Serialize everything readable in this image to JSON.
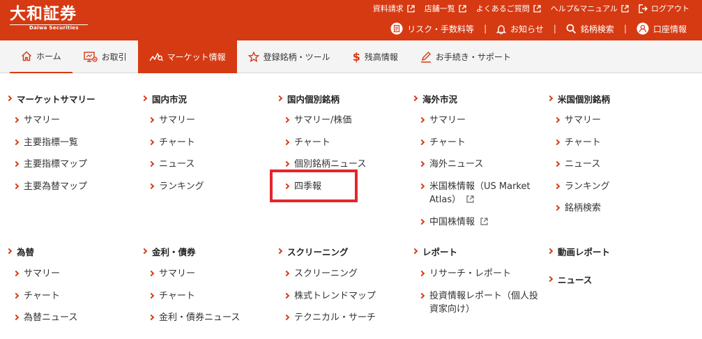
{
  "brand": {
    "logo_main": "大和証券",
    "logo_sub": "Daiwa Securities"
  },
  "top_links": [
    "資料請求",
    "店舗一覧",
    "よくあるご質問",
    "ヘルプ&マニュアル",
    "ログアウト"
  ],
  "sub_links": {
    "risk": "リスク・手数料等",
    "notice": "お知らせ",
    "search": "銘柄検索",
    "account": "口座情報"
  },
  "nav": {
    "home": "ホーム",
    "trade": "お取引",
    "market": "マーケット情報",
    "watchlist": "登録銘柄・ツール",
    "balance": "残高情報",
    "procedures": "お手続き・サポート"
  },
  "menu": {
    "market_summary": {
      "title": "マーケットサマリー",
      "items": [
        "サマリー",
        "主要指標一覧",
        "主要指標マップ",
        "主要為替マップ"
      ]
    },
    "domestic": {
      "title": "国内市況",
      "items": [
        "サマリー",
        "チャート",
        "ニュース",
        "ランキング"
      ]
    },
    "domestic_stocks": {
      "title": "国内個別銘柄",
      "items": [
        "サマリー/株価",
        "チャート",
        "個別銘柄ニュース",
        "四季報"
      ]
    },
    "overseas": {
      "title": "海外市況",
      "items": [
        "サマリー",
        "チャート",
        "海外ニュース",
        "米国株情報（US Market Atlas）",
        "中国株情報"
      ]
    },
    "us_stocks": {
      "title": "米国個別銘柄",
      "items": [
        "サマリー",
        "チャート",
        "ニュース",
        "ランキング",
        "銘柄検索"
      ]
    },
    "fx": {
      "title": "為替",
      "items": [
        "サマリー",
        "チャート",
        "為替ニュース"
      ]
    },
    "rates": {
      "title": "金利・債券",
      "items": [
        "サマリー",
        "チャート",
        "金利・債券ニュース"
      ]
    },
    "screening": {
      "title": "スクリーニング",
      "items": [
        "スクリーニング",
        "株式トレンドマップ",
        "テクニカル・サーチ"
      ]
    },
    "report": {
      "title": "レポート",
      "items": [
        "リサーチ・レポート",
        "投資情報レポート（個人投資家向け）"
      ]
    },
    "video": {
      "title": "動画レポート"
    },
    "news": {
      "title": "ニュース"
    }
  },
  "colors": {
    "brand": "#d63a12",
    "highlight": "#e3262b"
  }
}
